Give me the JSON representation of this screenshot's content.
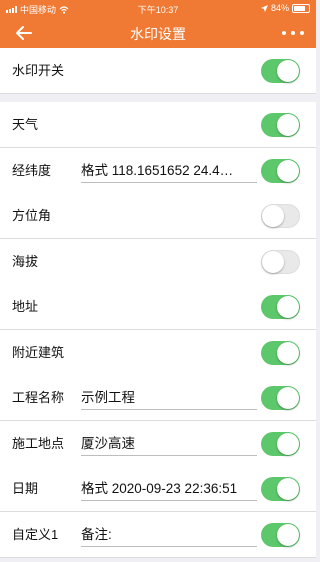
{
  "status": {
    "carrier": "中国移动",
    "time": "下午10:37",
    "battery": "84%"
  },
  "nav": {
    "title": "水印设置"
  },
  "colors": {
    "accent": "#f07a33",
    "toggle_on": "#5cc86b",
    "toggle_off": "#e9e9ea"
  },
  "master": {
    "label": "水印开关",
    "on": true
  },
  "rows": [
    {
      "label": "天气",
      "value": "",
      "on": true
    },
    {
      "label": "经纬度",
      "value": "格式 118.1651652 24.4…",
      "on": true
    },
    {
      "label": "方位角",
      "value": "",
      "on": false
    },
    {
      "label": "海拔",
      "value": "",
      "on": false
    },
    {
      "label": "地址",
      "value": "",
      "on": true
    },
    {
      "label": "附近建筑",
      "value": "",
      "on": true
    },
    {
      "label": "工程名称",
      "value": "示例工程",
      "on": true
    },
    {
      "label": "施工地点",
      "value": "厦沙高速",
      "on": true
    },
    {
      "label": "日期",
      "value": "格式 2020-09-23 22:36:51",
      "on": true
    },
    {
      "label": "自定义1",
      "value": "备注:",
      "on": true
    }
  ]
}
